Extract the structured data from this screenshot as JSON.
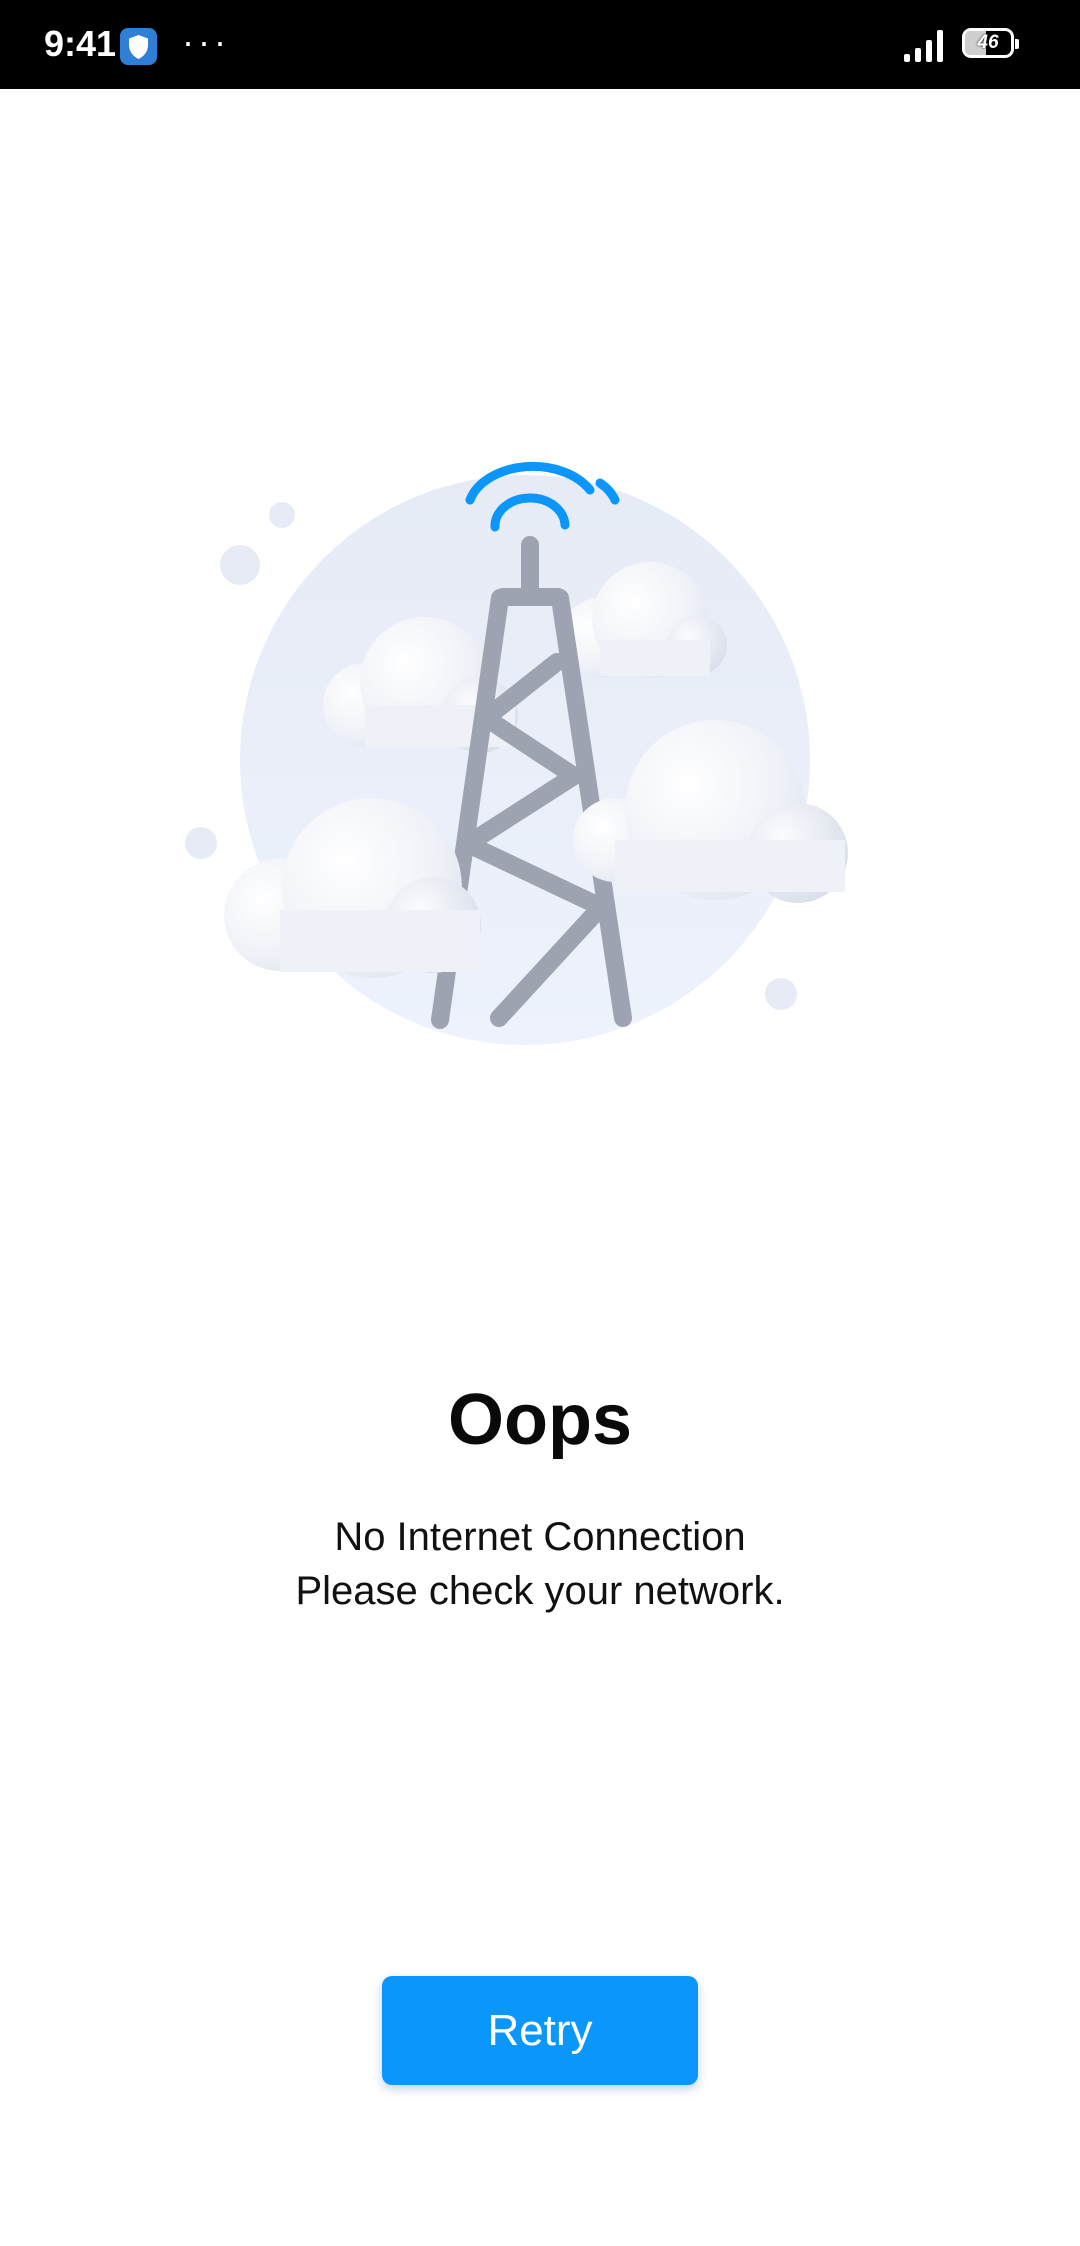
{
  "status_bar": {
    "time": "9:41",
    "more_indicator": "···",
    "battery_level": 46,
    "battery_text": "46",
    "icons": [
      "shield-icon",
      "cellular-signal-icon",
      "battery-icon"
    ],
    "shield_color": "#2f7fd6"
  },
  "illustration": {
    "icon": "cell-tower-with-clouds-icon",
    "signal_color": "#0a96fb",
    "tower_color": "#9da3b1",
    "circle_color": "#e8edf8"
  },
  "error": {
    "title": "Oops",
    "line1": "No Internet Connection",
    "line2": "Please check your network."
  },
  "actions": {
    "retry_label": "Retry",
    "retry_color": "#0a96fb"
  }
}
